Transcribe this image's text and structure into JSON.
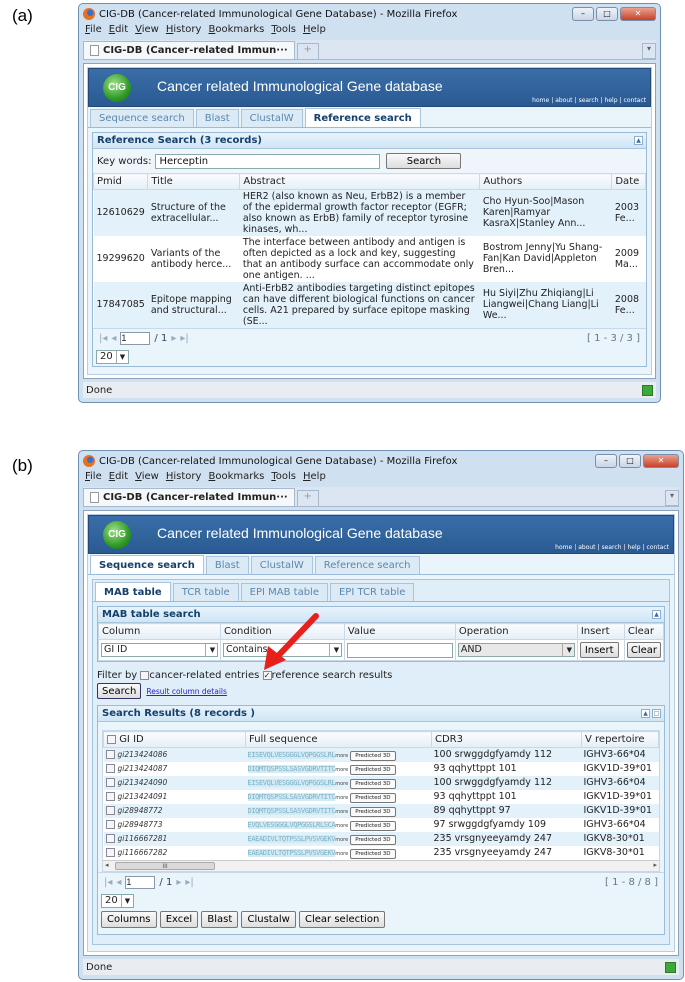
{
  "labels": {
    "a": "(a)",
    "b": "(b)"
  },
  "browser": {
    "title": "CIG-DB (Cancer-related Immunological Gene Database) - Mozilla Firefox",
    "menu": [
      "File",
      "Edit",
      "View",
      "History",
      "Bookmarks",
      "Tools",
      "Help"
    ],
    "tab_label": "CIG-DB (Cancer-related Immun···",
    "new_tab": "+",
    "status": "Done",
    "window_buttons": {
      "minimize": "–",
      "maximize": "□",
      "close": "✕"
    }
  },
  "site": {
    "logo": "CIG",
    "title": "Cancer related Immunological Gene database",
    "links": [
      "home",
      "about",
      "search",
      "help",
      "contact"
    ],
    "tabs": [
      "Sequence search",
      "Blast",
      "ClustalW",
      "Reference search"
    ]
  },
  "panel_a": {
    "header": "Reference Search (3 records)",
    "keywords_label": "Key words:",
    "keywords_value": "Herceptin",
    "search_button": "Search",
    "columns": [
      "Pmid",
      "Title",
      "Abstract",
      "Authors",
      "Date"
    ],
    "rows": [
      [
        "12610629",
        "Structure of the extracellular...",
        "HER2 (also known as Neu, ErbB2) is a member of the epidermal growth factor receptor (EGFR; also known as ErbB) family of receptor tyrosine kinases, wh...",
        "Cho Hyun-Soo|Mason Karen|Ramyar KasraX|Stanley Ann...",
        "2003 Fe..."
      ],
      [
        "19299620",
        "Variants of the antibody herce...",
        "The interface between antibody and antigen is often depicted as a lock and key, suggesting that an antibody surface can accommodate only one antigen. ...",
        "Bostrom Jenny|Yu Shang-Fan|Kan David|Appleton Bren...",
        "2009 Ma..."
      ],
      [
        "17847085",
        "Epitope mapping and structural...",
        "Anti-ErbB2 antibodies targeting distinct epitopes can have different biological functions on cancer cells. A21 prepared by surface epitope masking (SE...",
        "Hu Siyi|Zhu Zhiqiang|Li Liangwei|Chang Liang|Li We...",
        "2008 Fe..."
      ]
    ],
    "page": "1",
    "page_total": "/ 1",
    "range": "[ 1 - 3 / 3 ]",
    "page_size": "20"
  },
  "panel_b": {
    "subtabs": [
      "MAB table",
      "TCR table",
      "EPI MAB table",
      "EPI TCR table"
    ],
    "search_header": "MAB table search",
    "search_columns": [
      "Column",
      "Condition",
      "Value",
      "Operation",
      "Insert",
      "Clear"
    ],
    "column_value": "GI ID",
    "condition_value": "Contains",
    "value_value": "",
    "operation_value": "AND",
    "insert_button": "Insert",
    "clear_button": "Clear",
    "filter_label": "Filter by",
    "filter_cancer": "cancer-related entries",
    "filter_cancer_checked": false,
    "filter_reference": "reference search results",
    "filter_reference_checked": true,
    "search_button": "Search",
    "details_link": "Result column details",
    "results_header": "Search Results (8 records )",
    "result_columns": [
      "GI ID",
      "Full sequence",
      "CDR3",
      "V repertoire"
    ],
    "more_label": "more",
    "predicted_label": "Predicted 3D",
    "rows": [
      [
        "gi213424086",
        "EISEVQLVESGGGLVQPGGSLRL",
        "100 srwggdgfyamdy 112",
        "IGHV3-66*04"
      ],
      [
        "gi213424087",
        "DIQMTQSPSSLSASVGDRVTITC",
        "93 qqhyttppt 101",
        "IGKV1D-39*01"
      ],
      [
        "gi213424090",
        "EISEVQLVESGGGLVQPGGSLRL",
        "100 srwggdgfyamdy 112",
        "IGHV3-66*04"
      ],
      [
        "gi213424091",
        "DIQMTQSPSSLSASVGDRVTITC",
        "93 qqhyttppt 101",
        "IGKV1D-39*01"
      ],
      [
        "gi28948772",
        "DIQMTQSPSSLSASVGDRVTITC",
        "89 qqhyttppt 97",
        "IGKV1D-39*01"
      ],
      [
        "gi28948773",
        "EVQLVESGGGLVQPGGSLRLSCA",
        "97 srwggdgfyamdy 109",
        "IGHV3-66*04"
      ],
      [
        "gi116667281",
        "EAEADIVLTQTPSSLPVSVGEKV",
        "235 vrsgnyeeyamdy 247",
        "IGKV8-30*01"
      ],
      [
        "gi116667282",
        "EAEADIVLTQTPSSLPVSVGEKV",
        "235 vrsgnyeeyamdy 247",
        "IGKV8-30*01"
      ]
    ],
    "scroll_thumb": "III",
    "page": "1",
    "page_total": "/ 1",
    "range": "[ 1 - 8 / 8 ]",
    "page_size": "20",
    "bottom_buttons": [
      "Columns",
      "Excel",
      "Blast",
      "Clustalw",
      "Clear selection"
    ]
  },
  "colors": {
    "banner": "#2a5a92",
    "arrow": "#e8201c",
    "tab_active_text": "#15406b"
  }
}
